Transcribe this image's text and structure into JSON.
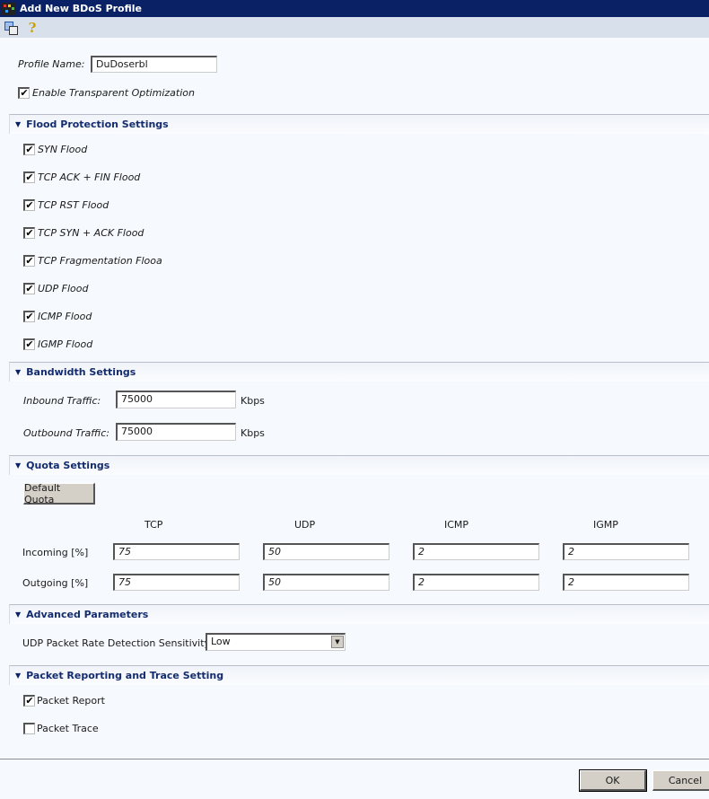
{
  "window": {
    "title": "Add New BDoS Profile"
  },
  "toolbar": {
    "icons": [
      "properties-icon",
      "help-icon"
    ],
    "help_glyph": "?"
  },
  "profile": {
    "name_label": "Profile Name:",
    "name_value": "DuDoserbl",
    "transparent_label": "Enable Transparent Optimization",
    "transparent_checked": true
  },
  "flood": {
    "title": "Flood Protection Settings",
    "items": [
      {
        "label": "SYN Flood",
        "checked": true
      },
      {
        "label": "TCP ACK + FIN Flood",
        "checked": true
      },
      {
        "label": "TCP RST Flood",
        "checked": true
      },
      {
        "label": "TCP SYN + ACK Flood",
        "checked": true
      },
      {
        "label": "TCP Fragmentation Flooa",
        "checked": true
      },
      {
        "label": "UDP Flood",
        "checked": true
      },
      {
        "label": "ICMP Flood",
        "checked": true
      },
      {
        "label": "IGMP Flood",
        "checked": true
      }
    ]
  },
  "bandwidth": {
    "title": "Bandwidth Settings",
    "inbound_label": "Inbound Traffic:",
    "inbound_value": "75000",
    "outbound_label": "Outbound Traffic:",
    "outbound_value": "75000",
    "unit": "Kbps"
  },
  "quota": {
    "title": "Quota Settings",
    "default_button": "Default Quota",
    "columns": [
      "TCP",
      "UDP",
      "ICMP",
      "IGMP"
    ],
    "rows": [
      {
        "label": "Incoming [%]",
        "values": [
          "75",
          "50",
          "2",
          "2"
        ]
      },
      {
        "label": "Outgoing [%]",
        "values": [
          "75",
          "50",
          "2",
          "2"
        ]
      }
    ]
  },
  "advanced": {
    "title": "Advanced Parameters",
    "udp_sensitivity_label": "UDP Packet Rate Detection Sensitivity:",
    "udp_sensitivity_value": "Low"
  },
  "reporting": {
    "title": "Packet Reporting and Trace Setting",
    "packet_report_label": "Packet Report",
    "packet_report_checked": true,
    "packet_trace_label": "Packet Trace",
    "packet_trace_checked": false
  },
  "footer": {
    "ok": "OK",
    "cancel": "Cancel"
  },
  "glyphs": {
    "check": "✔",
    "triangle": "▼"
  }
}
